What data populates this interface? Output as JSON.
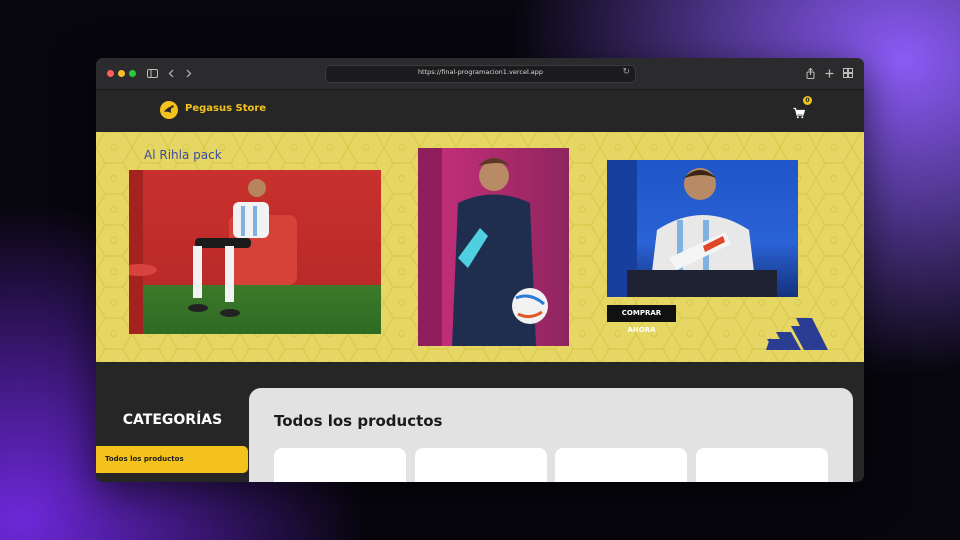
{
  "browser": {
    "url": "https://final-programacion1.vercel.app"
  },
  "site": {
    "brand": "Pegasus Store",
    "cart_count": "0"
  },
  "banner": {
    "title": "Al Rihla pack",
    "cta_label": "COMPRAR AHORA"
  },
  "sidebar": {
    "title": "CATEGORÍAS",
    "items": [
      {
        "label": "Todos los productos",
        "active": true
      }
    ]
  },
  "main": {
    "title": "Todos los productos"
  },
  "colors": {
    "accent": "#f4c21c",
    "banner_bg": "#e6d764",
    "header_bg": "#262626",
    "content_bg": "#e2e2e2"
  },
  "icons": [
    "sidebar-toggle-icon",
    "back-icon",
    "forward-icon",
    "reload-icon",
    "share-icon",
    "new-tab-icon",
    "tab-overview-icon",
    "pegasus-logo-icon",
    "cart-icon",
    "adidas-logo-icon"
  ]
}
